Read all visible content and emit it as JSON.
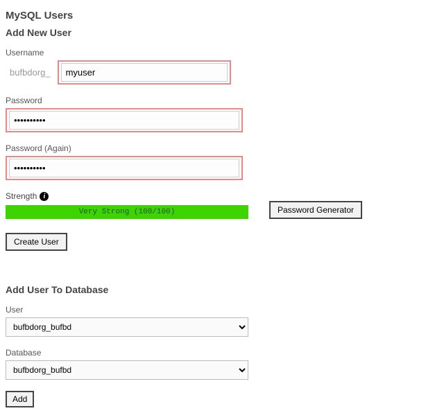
{
  "headings": {
    "main": "MySQL Users",
    "add_user": "Add New User",
    "add_to_db": "Add User To Database"
  },
  "form": {
    "username_label": "Username",
    "prefix": "bufbdorg_",
    "username_value": "myuser",
    "password_label": "Password",
    "password_value": "••••••••••",
    "password2_label": "Password (Again)",
    "password2_value": "••••••••••",
    "strength_label": "Strength",
    "strength_text": "Very Strong (100/100)",
    "pwgen_label": "Password Generator",
    "create_label": "Create User"
  },
  "assign": {
    "user_label": "User",
    "user_selected": "bufbdorg_bufbd",
    "db_label": "Database",
    "db_selected": "bufbdorg_bufbd",
    "add_label": "Add"
  }
}
